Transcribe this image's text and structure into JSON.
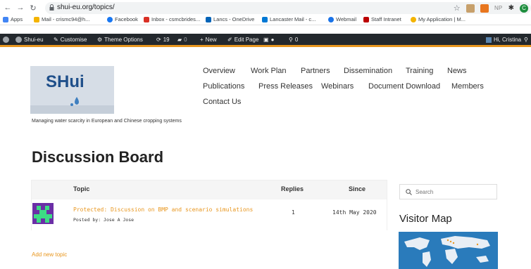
{
  "browser": {
    "url": "shui-eu.org/topics/",
    "bookmarks": [
      "Apps",
      "Mail - crismc94@h...",
      "Facebook",
      "Inbox - csmcbrides...",
      "Lancs - OneDrive",
      "Lancaster Mail - c...",
      "Webmail",
      "Staff Intranet",
      "My Application | M..."
    ],
    "ext_np": "NP"
  },
  "wpbar": {
    "site": "Shui-eu",
    "customise": "Customise",
    "theme": "Theme Options",
    "updates": "19",
    "comments": "0",
    "new": "New",
    "edit": "Edit Page",
    "counter": "0",
    "greeting": "Hi, Cristina"
  },
  "site": {
    "logo_text": "SHui",
    "tagline": "Managing water scarcity in European and Chinese cropping systems",
    "nav": [
      "Overview",
      "Work Plan",
      "Partners",
      "Dissemination",
      "Training",
      "News",
      "Publications",
      "Press Releases",
      "Webinars",
      "Document Download",
      "Members",
      "Contact Us"
    ]
  },
  "page": {
    "title": "Discussion Board",
    "add_new_topic": "Add new topic"
  },
  "table": {
    "headers": [
      "Topic",
      "Replies",
      "Since"
    ],
    "rows": [
      {
        "topic": "Protected: Discussion on BMP and scenario simulations",
        "posted_by": "Posted by: Jose A Jose",
        "replies": "1",
        "since": "14th May 2020"
      }
    ]
  },
  "sidebar": {
    "search_placeholder": "Search",
    "visitor_map_title": "Visitor Map"
  },
  "colors": {
    "accent": "#e8961e",
    "admin_bar": "#23282d"
  }
}
